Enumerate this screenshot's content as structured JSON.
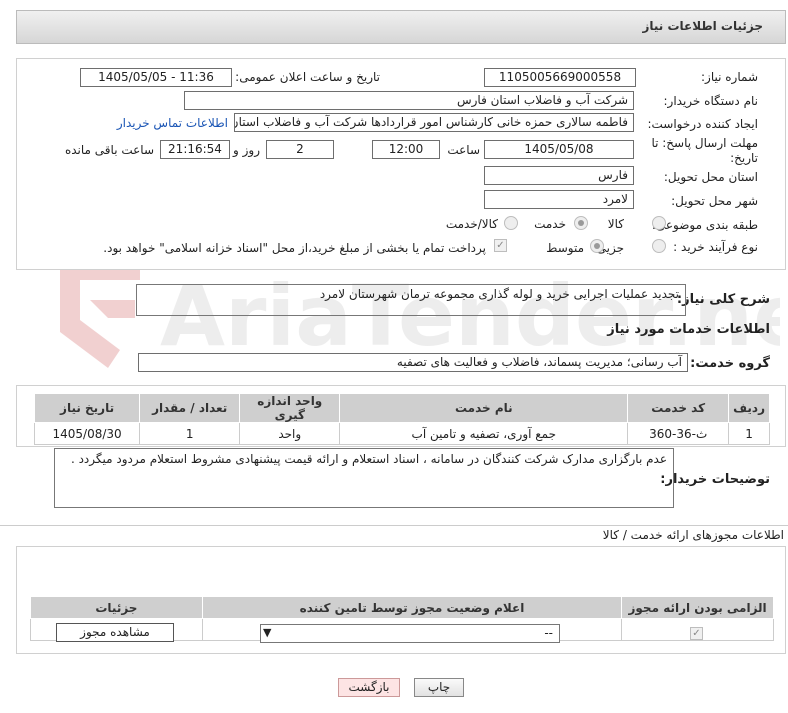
{
  "header": {
    "title": "جزئیات اطلاعات نیاز"
  },
  "form": {
    "need_number_label": "شماره نیاز:",
    "need_number": "1105005669000558",
    "announce_label": "تاریخ و ساعت اعلان عمومی:",
    "announce_value": "1405/05/05 - 11:36",
    "buyer_org_label": "نام دستگاه خریدار:",
    "buyer_org": "شرکت آب و فاضلاب استان فارس",
    "requester_label": "ایجاد کننده درخواست:",
    "requester": "فاطمه سالاری حمزه خانی کارشناس امور قراردادها شرکت آب و فاضلاب استان فارس",
    "contact_link": "اطلاعات تماس خریدار",
    "deadline_label": "مهلت ارسال پاسخ: تا تاریخ:",
    "deadline_date": "1405/05/08",
    "hour_label": "ساعت",
    "deadline_time": "12:00",
    "days_value": "2",
    "days_label": "روز و",
    "remaining_time": "21:16:54",
    "remaining_label": "ساعت باقی مانده",
    "province_label": "استان محل تحویل:",
    "province": "فارس",
    "city_label": "شهر محل تحویل:",
    "city": "لامرد",
    "category_label": "طبقه بندی موضوعی:",
    "category_options": [
      "کالا",
      "خدمت",
      "کالا/خدمت"
    ],
    "category_selected": "خدمت",
    "process_label": "نوع فرآیند خرید :",
    "process_options": [
      "جزیی",
      "متوسط"
    ],
    "process_selected": "متوسط",
    "payment_note": "پرداخت تمام یا بخشی از مبلغ خرید،از محل \"اسناد خزانه اسلامی\" خواهد بود."
  },
  "summary": {
    "label": "شرح کلی نیاز:",
    "text": "تجدید عملیات اجرایی خرید و لوله گذاری مجموعه ترمان شهرستان لامرد"
  },
  "services": {
    "section_title": "اطلاعات خدمات مورد نیاز",
    "group_label": "گروه خدمت:",
    "group_value": "آب رسانی؛ مدیریت پسماند، فاضلاب و فعالیت های تصفیه",
    "columns": [
      "ردیف",
      "کد خدمت",
      "نام خدمت",
      "واحد اندازه گیری",
      "تعداد / مقدار",
      "تاریخ نیاز"
    ],
    "rows": [
      [
        "1",
        "ث-36-360",
        "جمع آوری، تصفیه و تامین آب",
        "واحد",
        "1",
        "1405/08/30"
      ]
    ]
  },
  "buyer_notes": {
    "label": "توضیحات خریدار:",
    "text": "عدم بارگزاری مدارک شرکت کنندگان در سامانه ، اسناد استعلام و ارائه قیمت پیشنهادی مشروط استعلام مردود میگردد ."
  },
  "permits": {
    "title": "اطلاعات مجوزهای ارائه خدمت / کالا",
    "columns": [
      "الزامی بودن ارائه مجوز",
      "اعلام وضعیت مجوز توسط تامین کننده",
      "جزئیات"
    ],
    "select_value": "--",
    "view_button": "مشاهده مجوز"
  },
  "footer": {
    "print_button": "چاپ",
    "back_button": "بازگشت"
  },
  "watermark": {
    "text": "AriaTender.neT"
  }
}
